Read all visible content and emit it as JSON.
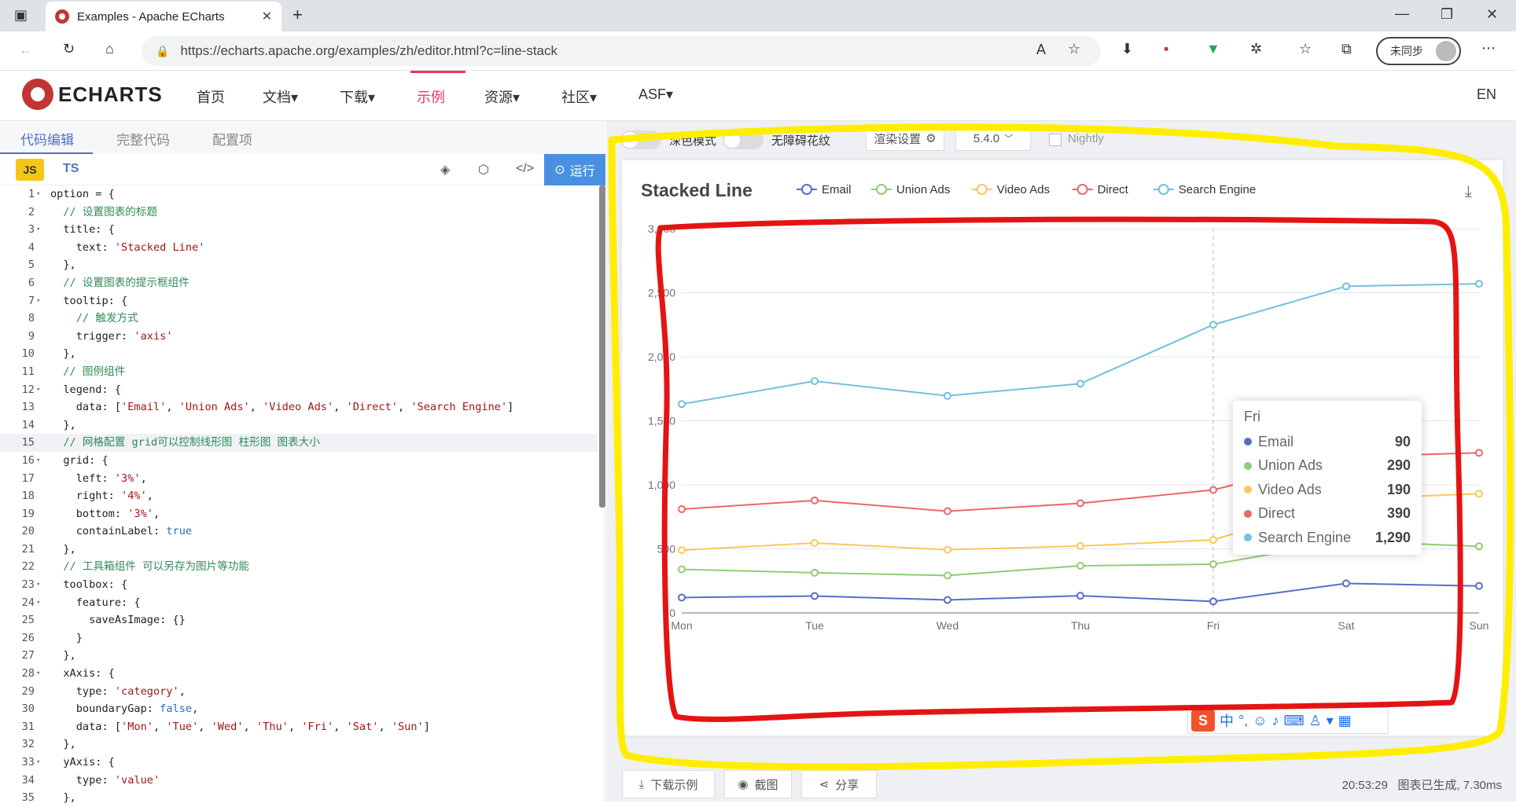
{
  "browser": {
    "tab_title": "Examples - Apache ECharts",
    "url": "https://echarts.apache.org/examples/zh/editor.html?c=line-stack",
    "sync_label": "未同步"
  },
  "site_nav": {
    "logo_text": "ECHARTS",
    "items": [
      "首页",
      "文档▾",
      "下载▾",
      "示例",
      "资源▾",
      "社区▾",
      "ASF▾"
    ],
    "active_item": "示例",
    "lang": "EN"
  },
  "editor": {
    "tabs": [
      "代码编辑",
      "完整代码",
      "配置项"
    ],
    "active_tab": "代码编辑",
    "lang_js": "JS",
    "lang_ts": "TS",
    "run_label": "运行",
    "highlighted_line": 15,
    "code_lines": [
      "option = {",
      "  // 设置图表的标题",
      "  title: {",
      "    text: 'Stacked Line'",
      "  },",
      "  // 设置图表的提示框组件",
      "  tooltip: {",
      "    // 触发方式",
      "    trigger: 'axis'",
      "  },",
      "  // 图例组件",
      "  legend: {",
      "    data: ['Email', 'Union Ads', 'Video Ads', 'Direct', 'Search Engine']",
      "  },",
      "  // 网格配置 grid可以控制线形图 柱形图 图表大小",
      "  grid: {",
      "    left: '3%',",
      "    right: '4%',",
      "    bottom: '3%',",
      "    containLabel: true",
      "  },",
      "  // 工具箱组件 可以另存为图片等功能",
      "  toolbox: {",
      "    feature: {",
      "      saveAsImage: {}",
      "    }",
      "  },",
      "  xAxis: {",
      "    type: 'category',",
      "    boundaryGap: false,",
      "    data: ['Mon', 'Tue', 'Wed', 'Thu', 'Fri', 'Sat', 'Sun']",
      "  },",
      "  yAxis: {",
      "    type: 'value'",
      "  },"
    ],
    "foldable_lines": [
      1,
      3,
      7,
      12,
      16,
      23,
      24,
      28,
      33
    ]
  },
  "preview": {
    "dark_mode_label": "深色模式",
    "accessibility_label": "无障碍花纹",
    "render_settings_label": "渲染设置",
    "version": "5.4.0",
    "nightly_label": "Nightly",
    "download_label": "下载示例",
    "screenshot_label": "截图",
    "share_label": "分享",
    "status_time": "20:53:29",
    "status_text": "图表已生成, 7.30ms"
  },
  "chart_data": {
    "type": "line",
    "title": "Stacked Line",
    "categories": [
      "Mon",
      "Tue",
      "Wed",
      "Thu",
      "Fri",
      "Sat",
      "Sun"
    ],
    "ylim": [
      0,
      3000
    ],
    "y_ticks": [
      "0",
      "500",
      "1,000",
      "1,500",
      "2,000",
      "2,500",
      "3,000"
    ],
    "stacked": true,
    "legend_position": "top",
    "series": [
      {
        "name": "Email",
        "color": "#5470c6",
        "values": [
          120,
          132,
          101,
          134,
          90,
          230,
          210
        ]
      },
      {
        "name": "Union Ads",
        "color": "#91cc75",
        "values": [
          220,
          182,
          191,
          234,
          290,
          330,
          310
        ]
      },
      {
        "name": "Video Ads",
        "color": "#fac858",
        "values": [
          150,
          232,
          201,
          154,
          190,
          330,
          410
        ]
      },
      {
        "name": "Direct",
        "color": "#ee6666",
        "values": [
          320,
          332,
          301,
          334,
          390,
          330,
          320
        ]
      },
      {
        "name": "Search Engine",
        "color": "#73c0de",
        "values": [
          820,
          932,
          901,
          934,
          1290,
          1330,
          1320
        ]
      }
    ],
    "tooltip": {
      "category": "Fri",
      "rows": [
        {
          "name": "Email",
          "value": "90"
        },
        {
          "name": "Union Ads",
          "value": "290"
        },
        {
          "name": "Video Ads",
          "value": "190"
        },
        {
          "name": "Direct",
          "value": "390"
        },
        {
          "name": "Search Engine",
          "value": "1,290"
        }
      ]
    }
  }
}
